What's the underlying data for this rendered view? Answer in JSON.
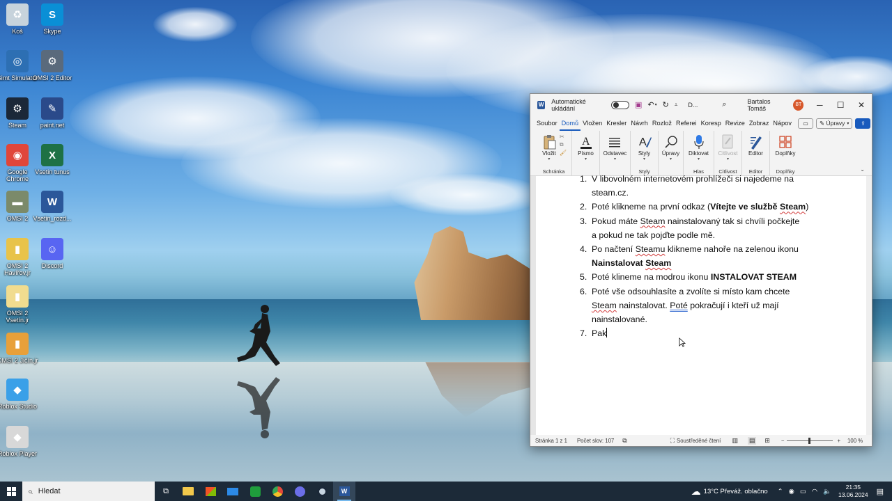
{
  "desktop": {
    "icons": [
      {
        "label": "Koš",
        "glyph": "♻",
        "color": "#c7d3dc",
        "icon": "recycle-bin-icon"
      },
      {
        "label": "Skype",
        "glyph": "S",
        "color": "#0a8fd6",
        "icon": "skype-icon"
      },
      {
        "label": "Simt Simulator",
        "glyph": "◎",
        "color": "#2d6fb3",
        "icon": "simulator-icon"
      },
      {
        "label": "OMSI 2 Editor",
        "glyph": "⚙",
        "color": "#5a6a7c",
        "icon": "omsi-editor-icon"
      },
      {
        "label": "Steam",
        "glyph": "⚙",
        "color": "#1b2838",
        "icon": "steam-icon"
      },
      {
        "label": "paint.net",
        "glyph": "✎",
        "color": "#2a4a8a",
        "icon": "paintnet-icon"
      },
      {
        "label": "Google Chrome",
        "glyph": "◉",
        "color": "#e0463a",
        "icon": "chrome-icon"
      },
      {
        "label": "Vsetin tunus",
        "glyph": "X",
        "color": "#1e7145",
        "icon": "excel-icon"
      },
      {
        "label": "OMSI 2",
        "glyph": "▬",
        "color": "#7b8a6a",
        "icon": "omsi-icon"
      },
      {
        "label": "Vsetin_rozd...",
        "glyph": "W",
        "color": "#2b579a",
        "icon": "word-doc-icon"
      },
      {
        "label": "OMSI 2 Havířov.jr",
        "glyph": "▮",
        "color": "#e8c34a",
        "icon": "folder-icon"
      },
      {
        "label": "Discord",
        "glyph": "☺",
        "color": "#5865f2",
        "icon": "discord-icon"
      },
      {
        "label": "OMSI 2 Vsetín.jr",
        "glyph": "▮",
        "color": "#f1dc8f",
        "icon": "file-icon"
      },
      {
        "label": "OMSI 2 Jičín.jr",
        "glyph": "▮",
        "color": "#e8a03a",
        "icon": "file-icon-2"
      },
      {
        "label": "Roblox Studio",
        "glyph": "◆",
        "color": "#3aa0e8",
        "icon": "roblox-studio-icon"
      },
      {
        "label": "Roblox Player",
        "glyph": "◆",
        "color": "#d8d8d8",
        "icon": "roblox-player-icon"
      }
    ]
  },
  "word": {
    "autosave_label": "Automatické ukládání",
    "doc_name": "D...",
    "user_name": "Bartalos Tomáš",
    "user_initials": "BT",
    "tabs": [
      "Soubor",
      "Domů",
      "Vložen",
      "Kresler",
      "Návrh",
      "Rozlož",
      "Referei",
      "Koresp",
      "Revize",
      "Zobraz",
      "Nápov"
    ],
    "active_tab": "Domů",
    "edit_button": "Úpravy",
    "ribbon": {
      "vlozit": "Vložit",
      "pismo": "Písmo",
      "odstavec": "Odstavec",
      "styly": "Styly",
      "upravy": "Úpravy",
      "diktovat": "Diktovat",
      "citlivost": "Citlivost",
      "editor": "Editor",
      "doplnky": "Doplňky",
      "g_schranka": "Schránka",
      "g_styly": "Styly",
      "g_hlas": "Hlas",
      "g_citlivost": "Citlivost",
      "g_editor": "Editor",
      "g_doplnky": "Doplňky"
    },
    "document": {
      "items": [
        {
          "num": "1.",
          "l1": "V libovolném internetovém prohlížeči si najedeme na",
          "l2": "steam.cz."
        },
        {
          "num": "2.",
          "pre": "Poté klikneme na první odkaz (",
          "bold": "Vítejte ve službě ",
          "bold_sq": "Steam",
          "post": ")"
        },
        {
          "num": "3.",
          "a": "Pokud máte ",
          "sq": "Steam",
          "b": " nainstalovaný tak si chvíli počkejte",
          "l2": "a pokud ne tak pojďte podle mě."
        },
        {
          "num": "4.",
          "a": " Po načtení ",
          "sq": "Steamu",
          "b": " klikneme nahoře na zelenou ikonu",
          "bold_l2": "Nainstalovat ",
          "bold_l2_sq": "Steam"
        },
        {
          "num": "5.",
          "a": "Poté klineme na modrou ikonu ",
          "bold": "INSTALOVAT STEAM"
        },
        {
          "num": "6.",
          "l1": "Poté vše odsouhlasíte a zvolíte si místo kam chcete",
          "l2_sq": "Steam",
          "l2_a": " nainstalovat. ",
          "l2_blue": "Poté",
          "l2_b": " pokračují i kteří už mají",
          "l3": "nainstalované."
        },
        {
          "num": "7.",
          "text": "Pak"
        }
      ]
    },
    "status": {
      "page": "Stránka 1 z 1",
      "words": "Počet slov: 107",
      "focus": "Soustředěné čtení",
      "zoom": "100 %"
    }
  },
  "taskbar": {
    "search_label": "Hledat",
    "weather": "13°C  Převáž. oblačno",
    "time": "21:35",
    "date": "13.06.2024"
  }
}
